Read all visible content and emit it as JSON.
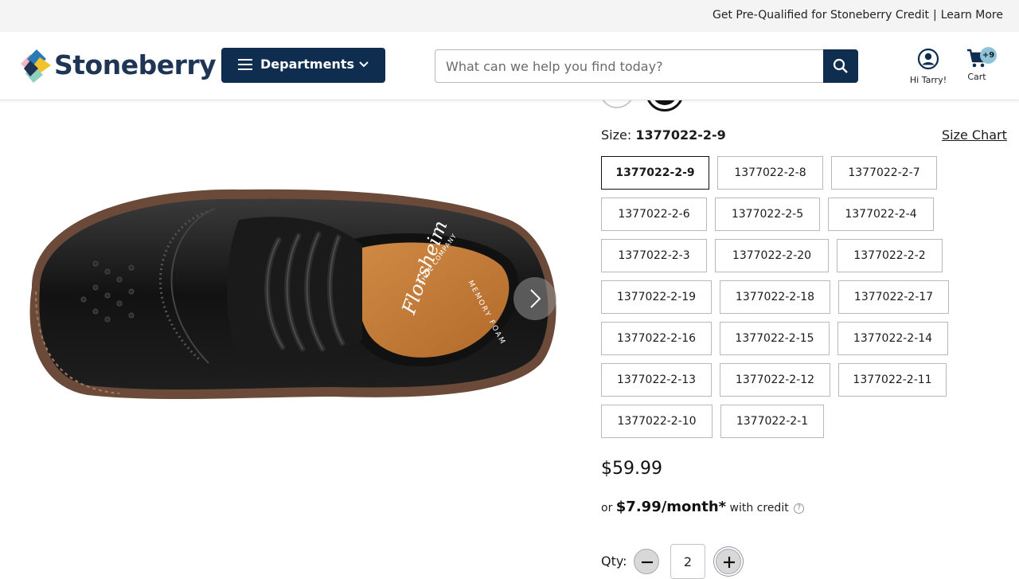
{
  "topbar": {
    "prequal_text": "Get Pre-Qualified for Stoneberry Credit",
    "separator": "|",
    "learn_more": "Learn More"
  },
  "header": {
    "logo_text": "Stoneberry",
    "departments_label": "Departments",
    "search_placeholder": "What can we help you find today?",
    "account_label": "Hi Tarry!",
    "cart_label": "Cart",
    "cart_badge": "+9"
  },
  "product": {
    "size_prefix": "Size:",
    "selected_size": "1377022-2-9",
    "size_chart_label": "Size Chart",
    "sizes": [
      "1377022-2-9",
      "1377022-2-8",
      "1377022-2-7",
      "1377022-2-6",
      "1377022-2-5",
      "1377022-2-4",
      "1377022-2-3",
      "1377022-2-20",
      "1377022-2-2",
      "1377022-2-19",
      "1377022-2-18",
      "1377022-2-17",
      "1377022-2-16",
      "1377022-2-15",
      "1377022-2-14",
      "1377022-2-13",
      "1377022-2-12",
      "1377022-2-11",
      "1377022-2-10",
      "1377022-2-1"
    ],
    "price": "$59.99",
    "credit_prefix": "or",
    "credit_amount": "$7.99/month*",
    "credit_suffix": "with credit",
    "qty_label": "Qty:",
    "qty_value": "2"
  },
  "image": {
    "insole_brand": "Florsheim",
    "insole_text": "MEMORY FOAM",
    "insole_text_2": "SHOE COMPANY"
  },
  "colors": {
    "brand_navy": "#0f2d4f",
    "badge": "#8fc3d9"
  }
}
